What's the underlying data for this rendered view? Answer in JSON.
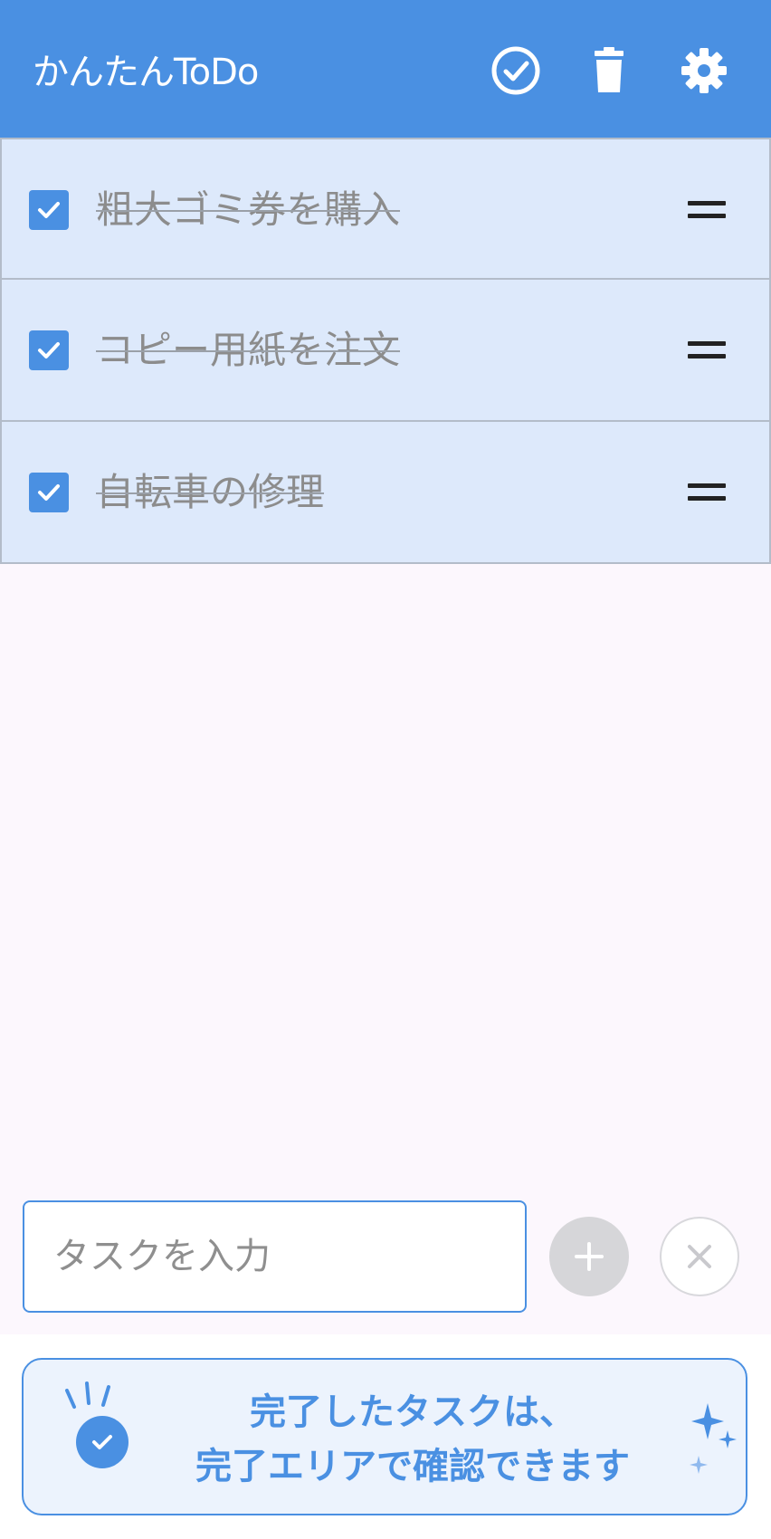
{
  "app_bar": {
    "title": "かんたんToDo",
    "actions": [
      {
        "name": "completed-icon"
      },
      {
        "name": "trash-icon"
      },
      {
        "name": "gear-icon"
      }
    ]
  },
  "tasks": [
    {
      "label": "粗大ゴミ券を購入",
      "checked": true
    },
    {
      "label": "コピー用紙を注文",
      "checked": true
    },
    {
      "label": "自転車の修理",
      "checked": true
    }
  ],
  "input": {
    "placeholder": "タスクを入力",
    "value": ""
  },
  "tip": {
    "line1": "完了したタスクは、",
    "line2": "完了エリアで確認できます"
  },
  "colors": {
    "primary": "#4a90e2",
    "row_bg": "#dde9fb",
    "page_bg": "#fcf7fd",
    "done_text": "#8c8c8c"
  }
}
